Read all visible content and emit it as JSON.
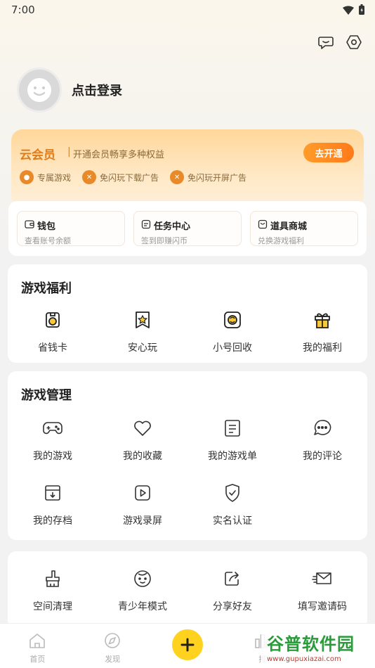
{
  "status": {
    "time": "7:00"
  },
  "profile": {
    "login_text": "点击登录"
  },
  "vip": {
    "brand": "云会员",
    "separator": "|",
    "desc": "开通会员畅享多种权益",
    "button": "去开通",
    "perks": [
      "专属游戏",
      "免闪玩下载广告",
      "免闪玩开屏广告"
    ]
  },
  "quick": [
    {
      "title": "钱包",
      "sub": "查看账号余额",
      "icon": "wallet-icon"
    },
    {
      "title": "任务中心",
      "sub": "签到即赚闪币",
      "icon": "task-icon"
    },
    {
      "title": "道具商城",
      "sub": "兑换游戏福利",
      "icon": "shop-icon"
    }
  ],
  "welfare": {
    "title": "游戏福利",
    "items": [
      {
        "label": "省钱卡",
        "icon": "save-card-icon"
      },
      {
        "label": "安心玩",
        "icon": "star-badge-icon"
      },
      {
        "label": "小号回收",
        "icon": "recycle-icon"
      },
      {
        "label": "我的福利",
        "icon": "gift-icon"
      }
    ]
  },
  "manage": {
    "title": "游戏管理",
    "items": [
      {
        "label": "我的游戏",
        "icon": "gamepad-icon"
      },
      {
        "label": "我的收藏",
        "icon": "heart-icon"
      },
      {
        "label": "我的游戏单",
        "icon": "list-icon"
      },
      {
        "label": "我的评论",
        "icon": "comment-icon"
      },
      {
        "label": "我的存档",
        "icon": "archive-icon"
      },
      {
        "label": "游戏录屏",
        "icon": "play-icon"
      },
      {
        "label": "实名认证",
        "icon": "shield-check-icon"
      }
    ]
  },
  "tools": {
    "items": [
      {
        "label": "空间清理",
        "icon": "broom-icon"
      },
      {
        "label": "青少年模式",
        "icon": "child-icon"
      },
      {
        "label": "分享好友",
        "icon": "share-icon"
      },
      {
        "label": "填写邀请码",
        "icon": "invite-icon"
      }
    ]
  },
  "tabbar": {
    "tabs": [
      {
        "label": "首页",
        "icon": "home-icon"
      },
      {
        "label": "发现",
        "icon": "compass-icon"
      },
      {
        "label": "",
        "icon": "plus-icon"
      },
      {
        "label": "排",
        "icon": "rank-icon"
      },
      {
        "label": "",
        "icon": "profile-icon"
      }
    ]
  },
  "watermark": {
    "title": "谷普软件园",
    "url": "www.gupuxiazai.com"
  },
  "colors": {
    "accent": "#ffd21f",
    "vip_orange": "#ff8a1f",
    "icon_yellow": "#f7c93a"
  }
}
